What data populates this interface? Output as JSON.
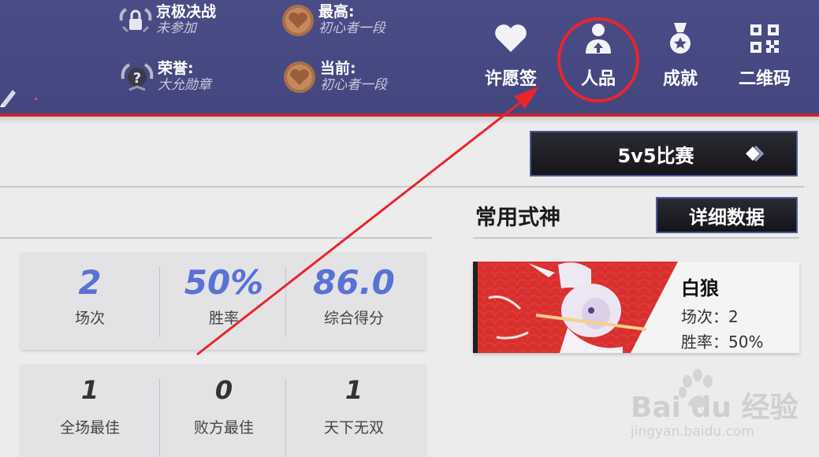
{
  "header": {
    "badges": [
      {
        "title": "京极决战",
        "sub": "未参加",
        "icon": "lock-wreath-icon"
      },
      {
        "title": "荣誉:",
        "sub": "大允勋章",
        "icon": "question-wreath-icon"
      },
      {
        "title": "最高:",
        "sub": "初心者一段",
        "icon": "heart-medal-icon"
      },
      {
        "title": "当前:",
        "sub": "初心者一段",
        "icon": "heart-medal-icon"
      }
    ],
    "nav": [
      {
        "label": "许愿签",
        "icon": "heart-icon"
      },
      {
        "label": "人品",
        "icon": "person-upload-icon"
      },
      {
        "label": "成就",
        "icon": "medal-icon"
      },
      {
        "label": "二维码",
        "icon": "qrcode-icon"
      }
    ]
  },
  "mode_button": {
    "label": "5v5比赛",
    "icon": "diamond-chevron-icon"
  },
  "common_shikigami": {
    "title": "常用式神",
    "detail_label": "详细数据"
  },
  "stats_top": [
    {
      "value": "2",
      "label": "场次"
    },
    {
      "value": "50%",
      "label": "胜率"
    },
    {
      "value": "86.0",
      "label": "综合得分"
    }
  ],
  "stats_bottom": [
    {
      "value": "1",
      "label": "全场最佳"
    },
    {
      "value": "0",
      "label": "败方最佳"
    },
    {
      "value": "1",
      "label": "天下无双"
    }
  ],
  "hero": {
    "name": "白狼",
    "matches": "场次：2",
    "winrate": "胜率：50%"
  },
  "watermark": {
    "brand": "Bai  du 经验",
    "url": "jingyan.baidu.com"
  },
  "colors": {
    "header": "#4a4c86",
    "accent_red": "#e8262c",
    "stat_blue": "#5a72d6"
  }
}
